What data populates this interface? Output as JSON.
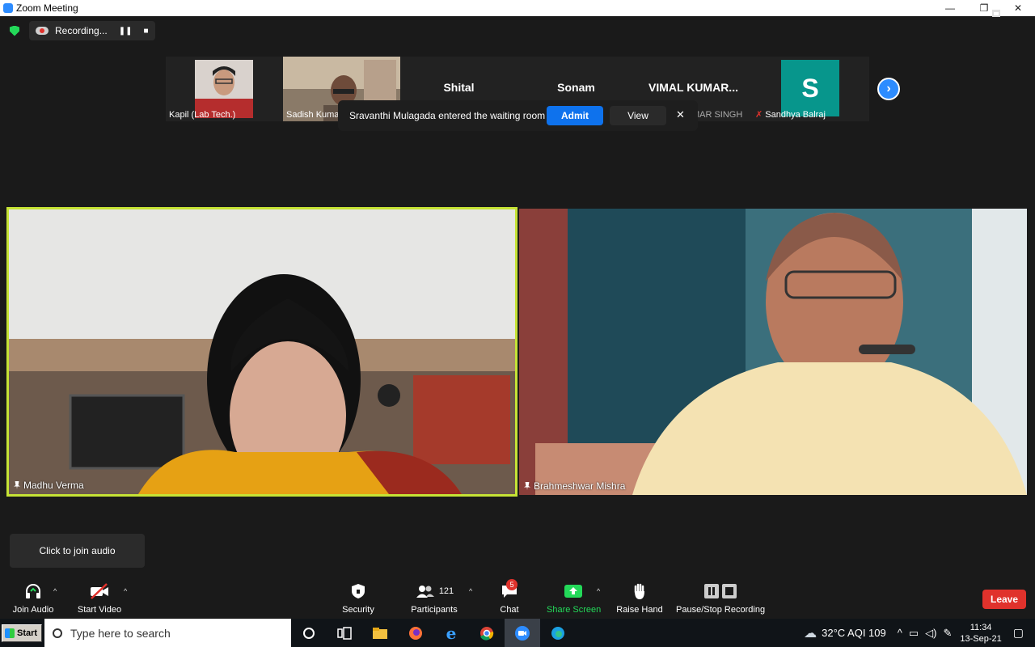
{
  "window": {
    "title": "Zoom Meeting",
    "controls": [
      "—",
      "❐",
      "✕"
    ]
  },
  "topbar": {
    "recording_label": "Recording...",
    "pause_glyph": "❚❚",
    "stop_glyph": "■",
    "view_label": "View"
  },
  "strip": {
    "participants": [
      {
        "name": "Kapil (Lab Tech.)",
        "big": ""
      },
      {
        "name": "Sadish Kumar",
        "big": ""
      },
      {
        "name": "",
        "big": "Shital"
      },
      {
        "name": "",
        "big": "Sonam"
      },
      {
        "name": "VIMAL KUMAR SINGH",
        "big": "VIMAL  KUMAR..."
      },
      {
        "name": "Sandhya Balraj",
        "big": "S"
      }
    ],
    "next_glyph": "›"
  },
  "waiting": {
    "message": "Sravanthi Mulagada entered the waiting room",
    "admit_label": "Admit",
    "view_label": "View",
    "close_glyph": "✕"
  },
  "tiles": {
    "left_name": "Madhu Verma",
    "right_name": "Brahmeshwar Mishra"
  },
  "tooltip": {
    "text": "Click to join audio"
  },
  "toolbar": {
    "join_audio": "Join Audio",
    "start_video": "Start Video",
    "security": "Security",
    "participants": "Participants",
    "participants_count": "121",
    "chat": "Chat",
    "chat_badge": "5",
    "share_screen": "Share Screen",
    "raise_hand": "Raise Hand",
    "recording": "Pause/Stop Recording",
    "leave": "Leave",
    "caret": "^"
  },
  "taskbar": {
    "start": "Start",
    "search_placeholder": "Type here to search",
    "weather": "32°C  AQI 109",
    "time": "11:34",
    "date": "13-Sep-21"
  },
  "colors": {
    "active_speaker": "#c6e335",
    "accent": "#2d8cff",
    "leave": "#e0322c",
    "share": "#23d959"
  }
}
